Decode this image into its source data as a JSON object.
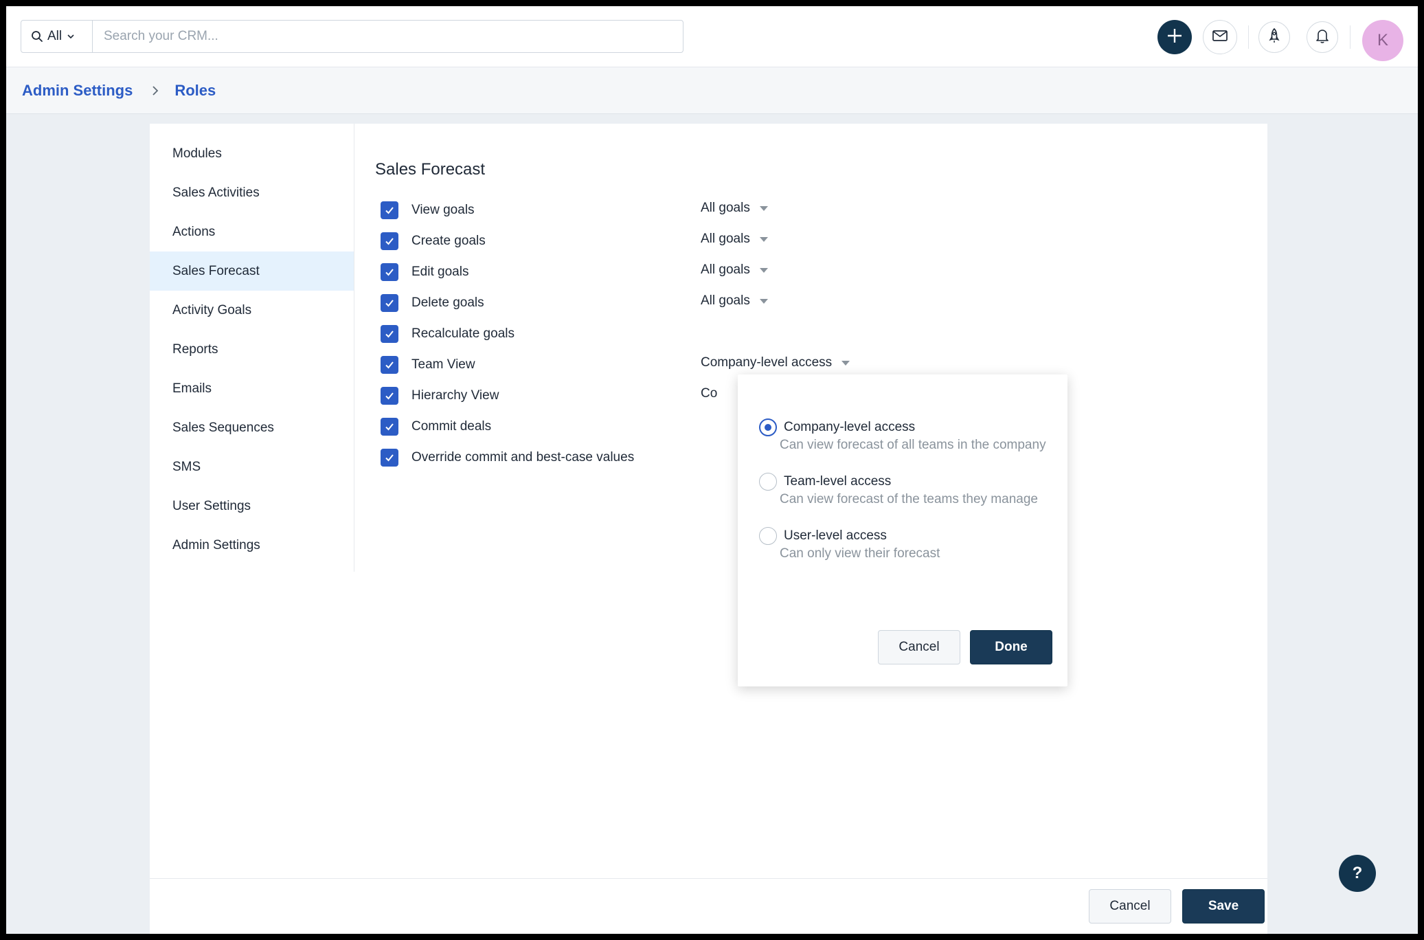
{
  "search": {
    "scope": "All",
    "placeholder": "Search your CRM..."
  },
  "header": {
    "actions": [
      "plus-icon",
      "mail-icon",
      "rocket-icon",
      "bell-icon"
    ],
    "avatar_initial": "K"
  },
  "breadcrumb": {
    "parent": "Admin Settings",
    "current": "Roles"
  },
  "sidebar": {
    "items": [
      {
        "label": "Modules"
      },
      {
        "label": "Sales Activities"
      },
      {
        "label": "Actions"
      },
      {
        "label": "Sales Forecast",
        "active": true
      },
      {
        "label": "Activity Goals"
      },
      {
        "label": "Reports"
      },
      {
        "label": "Emails"
      },
      {
        "label": "Sales Sequences"
      },
      {
        "label": "SMS"
      },
      {
        "label": "User Settings"
      },
      {
        "label": "Admin Settings"
      }
    ]
  },
  "section": {
    "title": "Sales Forecast",
    "permissions": [
      {
        "label": "View goals",
        "checked": true,
        "scope": "All goals"
      },
      {
        "label": "Create goals",
        "checked": true,
        "scope": "All goals"
      },
      {
        "label": "Edit goals",
        "checked": true,
        "scope": "All goals"
      },
      {
        "label": "Delete goals",
        "checked": true,
        "scope": "All goals"
      },
      {
        "label": "Recalculate goals",
        "checked": true,
        "scope": ""
      },
      {
        "label": "Team View",
        "checked": true,
        "scope": "Company-level access"
      },
      {
        "label": "Hierarchy View",
        "checked": true,
        "scope": "Co"
      },
      {
        "label": "Commit deals",
        "checked": true,
        "scope": ""
      },
      {
        "label": "Override commit and best-case values",
        "checked": true,
        "scope": ""
      }
    ]
  },
  "popover": {
    "options": [
      {
        "label": "Company-level access",
        "desc": "Can view forecast of all teams in the company",
        "selected": true
      },
      {
        "label": "Team-level access",
        "desc": "Can view forecast of the teams they manage",
        "selected": false
      },
      {
        "label": "User-level access",
        "desc": "Can only view their forecast",
        "selected": false
      }
    ],
    "cancel_label": "Cancel",
    "done_label": "Done"
  },
  "footer": {
    "cancel_label": "Cancel",
    "save_label": "Save"
  },
  "help": {
    "label": "?"
  },
  "colors": {
    "accent": "#2c5cc5",
    "primary_dark": "#12344d",
    "active_nav": "#e5f2fd",
    "avatar": "#e8b3e6"
  }
}
